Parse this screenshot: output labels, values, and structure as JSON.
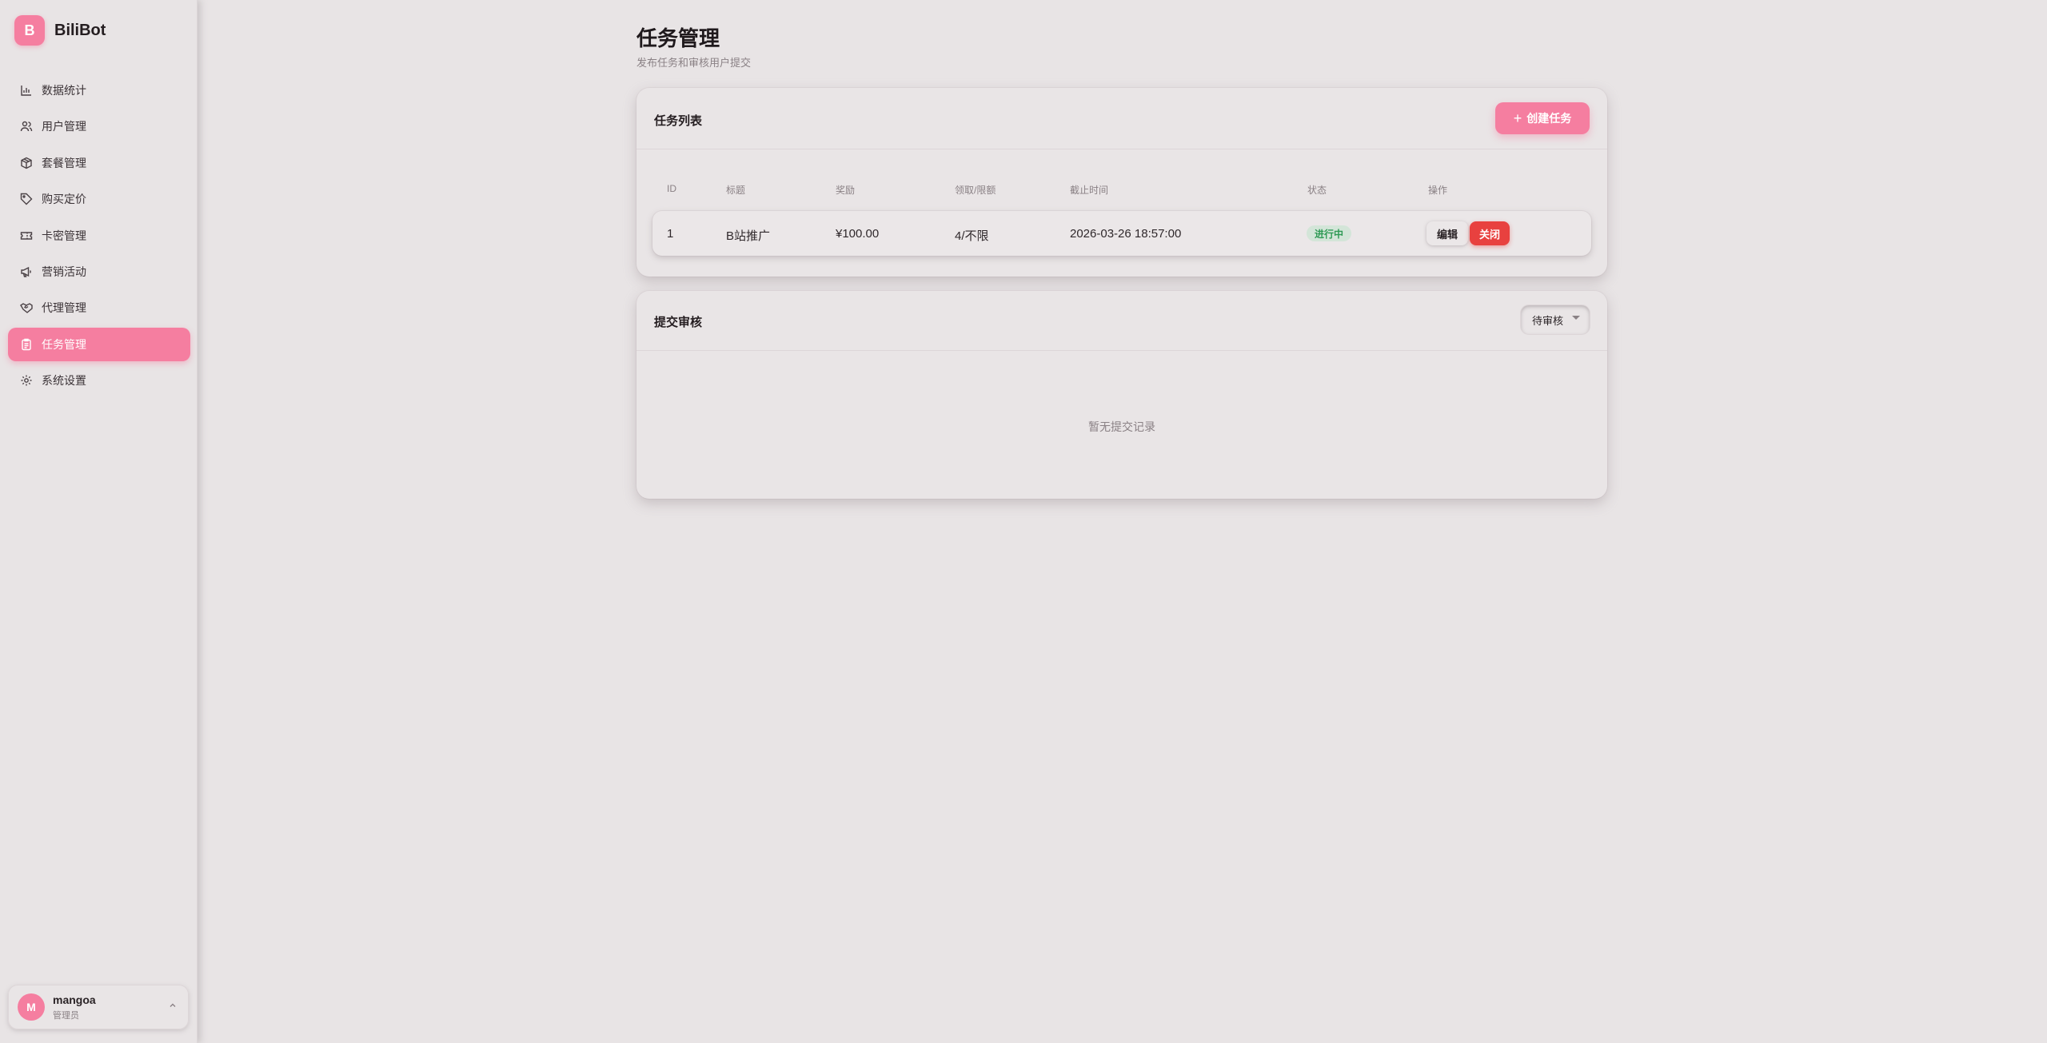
{
  "brand": {
    "logo_letter": "B",
    "name": "BiliBot",
    "accent": "#f57ea0"
  },
  "sidebar": {
    "items": [
      {
        "label": "数据统计",
        "icon": "bar-chart-icon",
        "active": false
      },
      {
        "label": "用户管理",
        "icon": "users-icon",
        "active": false
      },
      {
        "label": "套餐管理",
        "icon": "package-icon",
        "active": false
      },
      {
        "label": "购买定价",
        "icon": "tag-icon",
        "active": false
      },
      {
        "label": "卡密管理",
        "icon": "ticket-icon",
        "active": false
      },
      {
        "label": "营销活动",
        "icon": "megaphone-icon",
        "active": false
      },
      {
        "label": "代理管理",
        "icon": "handshake-icon",
        "active": false
      },
      {
        "label": "任务管理",
        "icon": "clipboard-icon",
        "active": true
      },
      {
        "label": "系统设置",
        "icon": "gear-icon",
        "active": false
      }
    ]
  },
  "user": {
    "avatar_letter": "M",
    "name": "mangoa",
    "role": "管理员"
  },
  "page": {
    "title": "任务管理",
    "subtitle": "发布任务和审核用户提交"
  },
  "tasks": {
    "title": "任务列表",
    "create_label": "创建任务",
    "columns": [
      "ID",
      "标题",
      "奖励",
      "领取/限额",
      "截止时间",
      "状态",
      "操作"
    ],
    "rows": [
      {
        "id": "1",
        "title": "B站推广",
        "reward": "¥100.00",
        "quota": "4/不限",
        "deadline": "2026-03-26 18:57:00",
        "status": "进行中",
        "edit_label": "编辑",
        "close_label": "关闭"
      }
    ]
  },
  "review": {
    "title": "提交审核",
    "filter_value": "待审核",
    "empty_text": "暂无提交记录"
  },
  "colors": {
    "status_active": "#2f9a55",
    "danger": "#e8413f"
  }
}
